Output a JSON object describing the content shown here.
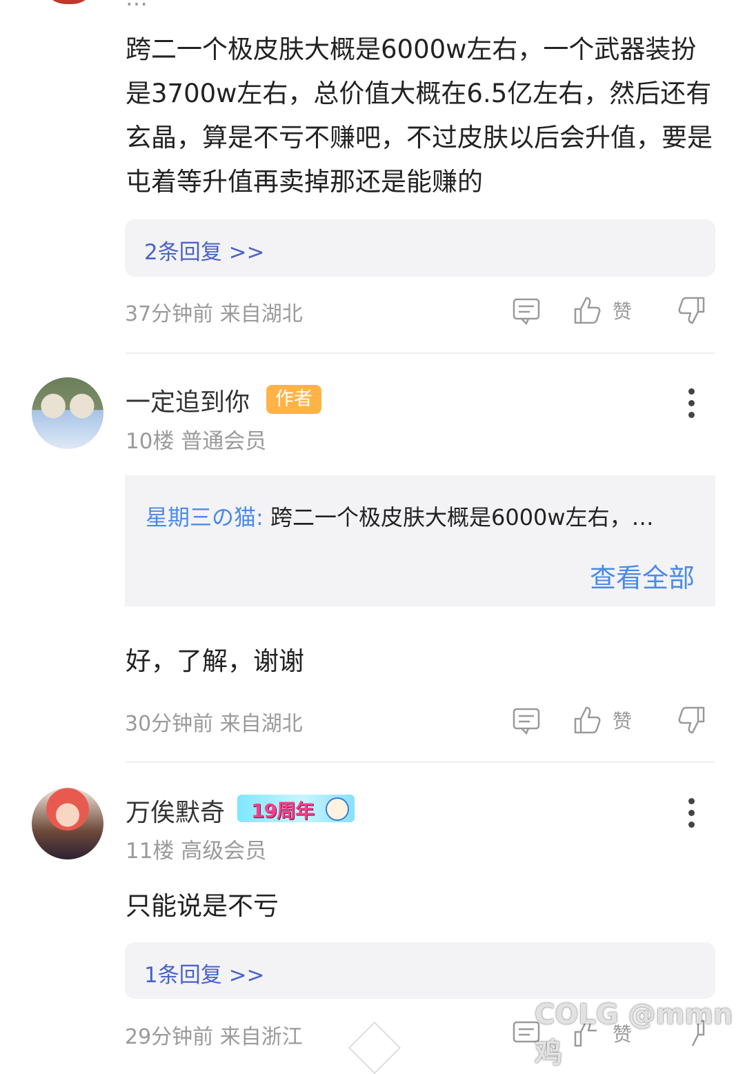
{
  "top_comment": {
    "username_fragment": "…",
    "body": "跨二一个极皮肤大概是6000w左右，一个武器装扮是3700w左右，总价值大概在6.5亿左右，然后还有玄晶，算是不亏不赚吧，不过皮肤以后会升值，要是屯着等升值再卖掉那还是能赚的",
    "replies_link": "2条回复 >>",
    "meta": "37分钟前 来自湖北",
    "like_label": "赞"
  },
  "comment_10": {
    "username": "一定追到你",
    "badge": "作者",
    "floor": "10楼 普通会员",
    "quote_user": "星期三の猫:",
    "quote_text": " 跨二一个极皮肤大概是6000w左右，…",
    "view_all": "查看全部",
    "body": "好，了解，谢谢",
    "meta": "30分钟前 来自湖北",
    "like_label": "赞"
  },
  "comment_11": {
    "username": "万俟默奇",
    "badge": "19周年",
    "floor": "11楼 高级会员",
    "body": "只能说是不亏",
    "replies_link": "1条回复 >>",
    "meta": "29分钟前 来自浙江",
    "like_label": "赞"
  },
  "watermark": "COLG @mmn鸡",
  "icons": {
    "comment": "comment-icon",
    "like": "thumb-up-icon",
    "dislike": "thumb-down-icon",
    "more": "more-vertical-icon"
  },
  "colors": {
    "link": "#4a63c6",
    "quote_link": "#4a8ae8",
    "author_badge": "#ffb347",
    "meta": "#9a9a9a"
  }
}
